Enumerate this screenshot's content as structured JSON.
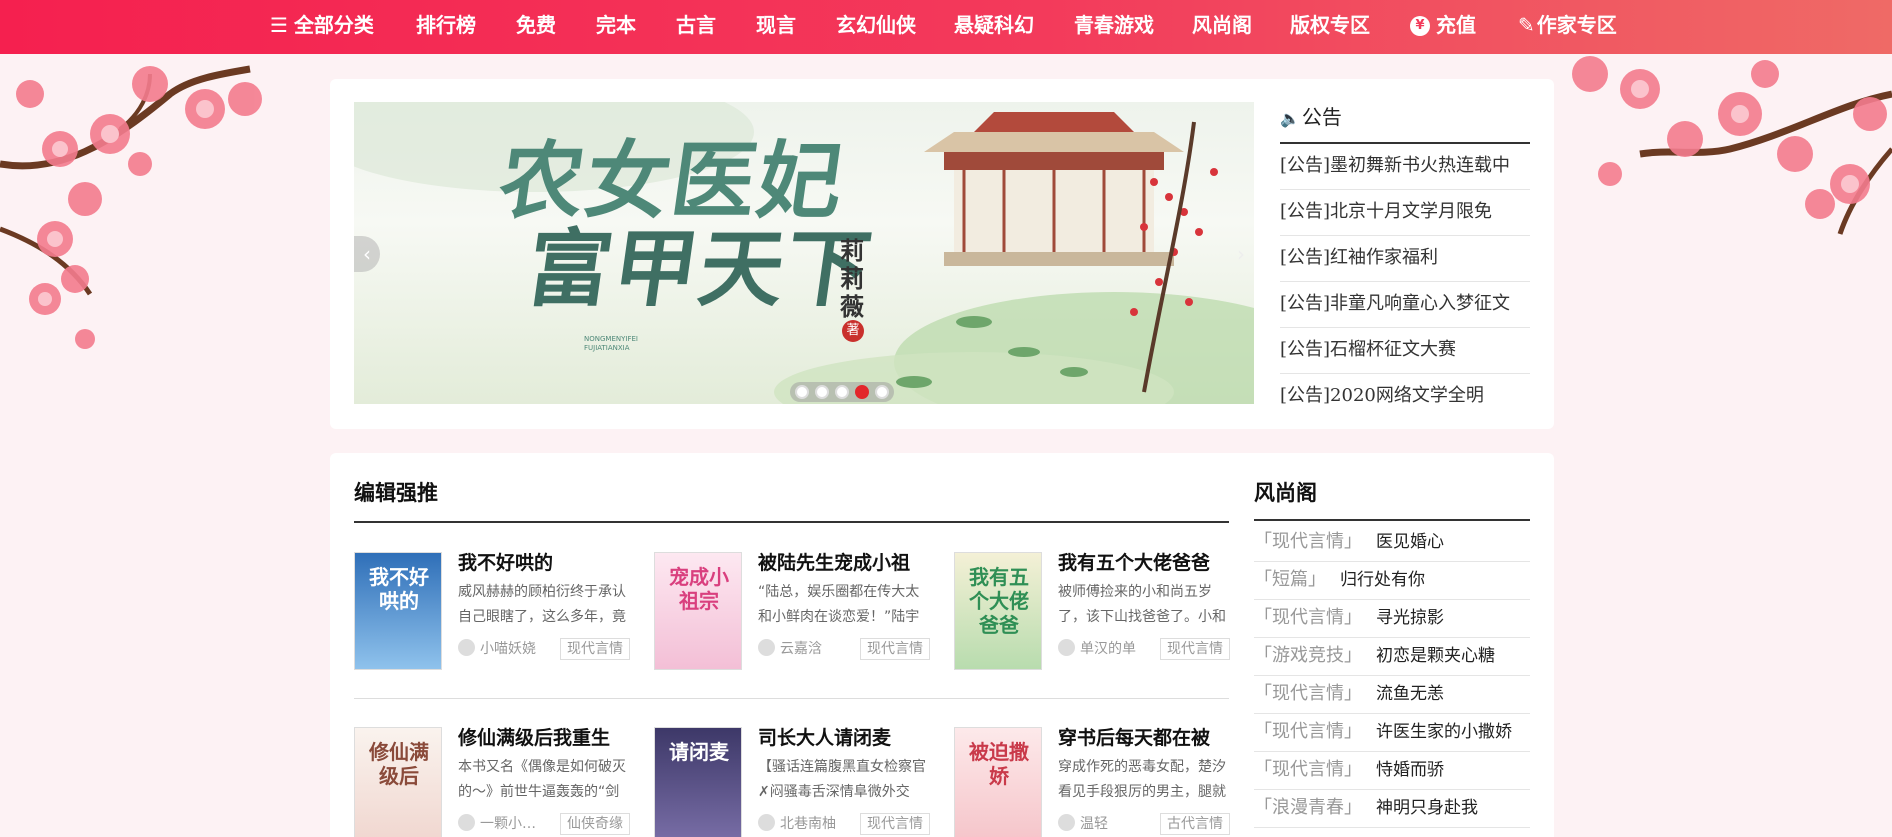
{
  "nav": {
    "items": [
      {
        "label": "全部分类",
        "icon": "menu-icon"
      },
      {
        "label": "排行榜"
      },
      {
        "label": "免费"
      },
      {
        "label": "完本"
      },
      {
        "label": "古言"
      },
      {
        "label": "现言"
      },
      {
        "label": "玄幻仙侠"
      },
      {
        "label": "悬疑科幻"
      },
      {
        "label": "青春游戏"
      },
      {
        "label": "风尚阁"
      },
      {
        "label": "版权专区"
      },
      {
        "label": "充值",
        "icon": "yen-icon"
      },
      {
        "label": "作家专区",
        "icon": "pen-icon"
      }
    ]
  },
  "banner": {
    "title_line1": "农女医妃",
    "title_line2": "富甲天下",
    "author": "莉莉薇",
    "seal": "著",
    "subtitle_line1": "NONGMENYIFEI",
    "subtitle_line2": "FUJIATIANXIA",
    "prev": "‹",
    "next": "›",
    "active_slide": 4,
    "slide_count": 5
  },
  "announcements": {
    "heading": "公告",
    "items": [
      "[公告]墨初舞新书火热连载中",
      "[公告]北京十月文学月限免",
      "[公告]红袖作家福利",
      "[公告]非童凡响童心入梦征文",
      "[公告]石榴杯征文大赛",
      "[公告]2020网络文学全明"
    ]
  },
  "editor_picks": {
    "heading": "编辑强推",
    "books": [
      {
        "title": "我不好哄的",
        "cover_text": "我不好哄的",
        "desc": "威风赫赫的顾柏衍终于承认自己眼瞎了，这么多年，竟",
        "author": "小喵妖娆",
        "tag": "现代言情",
        "cover_color": "#3a7fc4"
      },
      {
        "title": "被陆先生宠成小祖",
        "cover_text": "宠成小祖宗",
        "desc": "“陆总，娱乐圈都在传大太和小鲜肉在谈恋爱！”陆宇",
        "author": "云嘉浛",
        "tag": "现代言情",
        "cover_color": "#f3cfe0"
      },
      {
        "title": "我有五个大佬爸爸",
        "cover_text": "我有五个大佬爸爸",
        "desc": "被师傅捡来的小和尚五岁了，该下山找爸爸了。小和",
        "author": "单汉的单",
        "tag": "现代言情",
        "cover_color": "#cfe7c8"
      },
      {
        "title": "修仙满级后我重生",
        "cover_text": "修仙满级后",
        "desc": "本书又名《偶像是如何破灭的～》前世牛逼轰轰的“剑",
        "author": "一颗小…",
        "tag": "仙侠奇缘",
        "cover_color": "#f6e9e4"
      },
      {
        "title": "司长大人请闭麦",
        "cover_text": "请闭麦",
        "desc": "【骚话连篇腹黑直女检察官✗闷骚毒舌深情阜微外交",
        "author": "北巷南柚",
        "tag": "现代言情",
        "cover_color": "#4a4577"
      },
      {
        "title": "穿书后每天都在被",
        "cover_text": "被迫撒娇",
        "desc": "穿成作死的恶毒女配，楚汐看见手段狠厉的男主，腿就",
        "author": "温轻",
        "tag": "古代言情",
        "cover_color": "#f7d5d8"
      }
    ]
  },
  "fashion": {
    "heading": "风尚阁",
    "items": [
      {
        "cat": "「现代言情」",
        "name": "医见婚心"
      },
      {
        "cat": "「短篇」",
        "name": "归行处有你"
      },
      {
        "cat": "「现代言情」",
        "name": "寻光掠影"
      },
      {
        "cat": "「游戏竞技」",
        "name": "初恋是颗夹心糖"
      },
      {
        "cat": "「现代言情」",
        "name": "流鱼无恙"
      },
      {
        "cat": "「现代言情」",
        "name": "许医生家的小撒娇"
      },
      {
        "cat": "「现代言情」",
        "name": "恃婚而骄"
      },
      {
        "cat": "「浪漫青春」",
        "name": "神明只身赴我"
      }
    ]
  }
}
